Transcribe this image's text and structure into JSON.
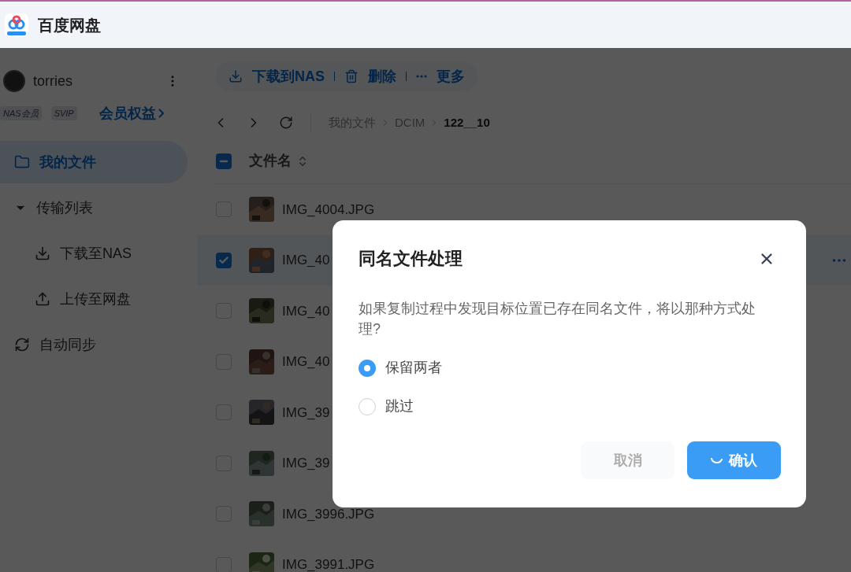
{
  "app": {
    "title": "百度网盘"
  },
  "sidebar": {
    "user": {
      "name": "torries"
    },
    "badges": [
      "NAS会员",
      "SVIP"
    ],
    "benefits_link": "会员权益",
    "items": [
      {
        "label": "我的文件",
        "kind": "folder",
        "selected": true
      },
      {
        "label": "传输列表",
        "kind": "group",
        "selected": false,
        "expanded": true,
        "children": [
          {
            "label": "下载至NAS",
            "kind": "download",
            "selected": false
          },
          {
            "label": "上传至网盘",
            "kind": "upload",
            "selected": false
          }
        ]
      },
      {
        "label": "自动同步",
        "kind": "sync",
        "selected": false
      }
    ]
  },
  "toolbar": [
    {
      "label": "下载到NAS",
      "kind": "download"
    },
    {
      "label": "删除",
      "kind": "delete"
    },
    {
      "label": "更多",
      "kind": "more"
    }
  ],
  "breadcrumb": [
    "我的文件",
    "DCIM",
    "122__10"
  ],
  "table": {
    "header": {
      "label": "文件名",
      "indeterminate": true
    },
    "rows": [
      {
        "name": "IMG_4004.JPG",
        "checked": false,
        "selected": false,
        "kind": "picture"
      },
      {
        "name": "IMG_40",
        "checked": true,
        "selected": true,
        "kind": "picture"
      },
      {
        "name": "IMG_40",
        "checked": false,
        "selected": false,
        "kind": "picture"
      },
      {
        "name": "IMG_40",
        "checked": false,
        "selected": false,
        "kind": "picture"
      },
      {
        "name": "IMG_39",
        "checked": false,
        "selected": false,
        "kind": "picture"
      },
      {
        "name": "IMG_39",
        "checked": false,
        "selected": false,
        "kind": "picture"
      },
      {
        "name": "IMG_3996.JPG",
        "checked": false,
        "selected": false,
        "kind": "picture"
      },
      {
        "name": "IMG_3991.JPG",
        "checked": false,
        "selected": false,
        "kind": "picture"
      }
    ]
  },
  "dialog": {
    "title": "同名文件处理",
    "message": "如果复制过程中发现目标位置已存在同名文件，将以那种方式处理?",
    "options": [
      {
        "label": "保留两者",
        "selected": true
      },
      {
        "label": "跳过",
        "selected": false
      }
    ],
    "buttons": [
      {
        "label": "取消",
        "kind": "secondary",
        "disabled": true,
        "loading": false
      },
      {
        "label": "确认",
        "kind": "primary",
        "disabled": false,
        "loading": true
      }
    ]
  }
}
